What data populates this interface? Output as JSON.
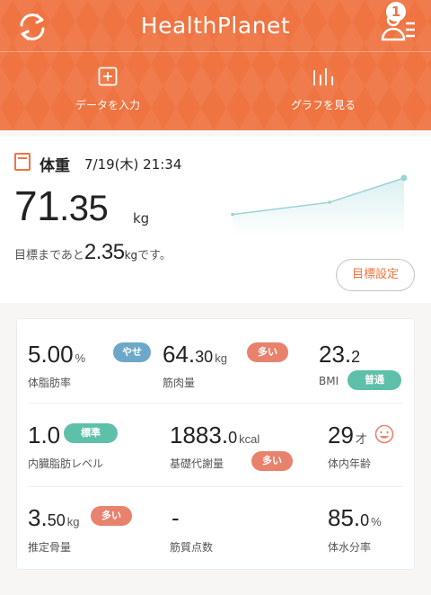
{
  "header": {
    "title": "HealthPlanet",
    "badge_count": "1",
    "actions": [
      {
        "label": "データを入力",
        "icon": "plus-box-icon"
      },
      {
        "label": "グラフを見る",
        "icon": "bar-chart-icon"
      }
    ]
  },
  "weight": {
    "title": "体重",
    "datetime": "7/19(木) 21:34",
    "value_int": "71",
    "value_dec": ".35",
    "unit": "kg",
    "goal_prefix": "目標まであと",
    "goal_value": "2.35",
    "goal_unit": "kg",
    "goal_suffix": "です。",
    "goal_button": "目標設定",
    "trend": [
      71.2,
      71.25,
      71.35
    ],
    "colors": {
      "accent": "#ef7442",
      "trend_line": "#9fd3d3"
    }
  },
  "metrics": [
    {
      "label": "体脂肪率",
      "major": "5.00",
      "minor": "",
      "unit": "%",
      "status": "やせ",
      "status_color": "blue"
    },
    {
      "label": "筋肉量",
      "major": "64.",
      "minor": "30",
      "unit": "kg",
      "status": "多い",
      "status_color": "red"
    },
    {
      "label": "BMI",
      "major": "23.",
      "minor": "2",
      "unit": "",
      "status": "普通",
      "status_color": "green"
    },
    {
      "label": "内臓脂肪レベル",
      "major": "1.0",
      "minor": "",
      "unit": "",
      "status": "標準",
      "status_color": "green"
    },
    {
      "label": "基礎代謝量",
      "major": "1883.",
      "minor": "0",
      "unit": "kcal",
      "status": "多い",
      "status_color": "red"
    },
    {
      "label": "体内年齢",
      "major": "29",
      "minor": "",
      "unit": "才",
      "status": "",
      "status_color": ""
    },
    {
      "label": "推定骨量",
      "major": "3.",
      "minor": "50",
      "unit": "kg",
      "status": "多い",
      "status_color": "red"
    },
    {
      "label": "筋質点数",
      "major": "-",
      "minor": "",
      "unit": "",
      "status": "",
      "status_color": ""
    },
    {
      "label": "体水分率",
      "major": "85.",
      "minor": "0",
      "unit": "%",
      "status": "",
      "status_color": ""
    }
  ]
}
